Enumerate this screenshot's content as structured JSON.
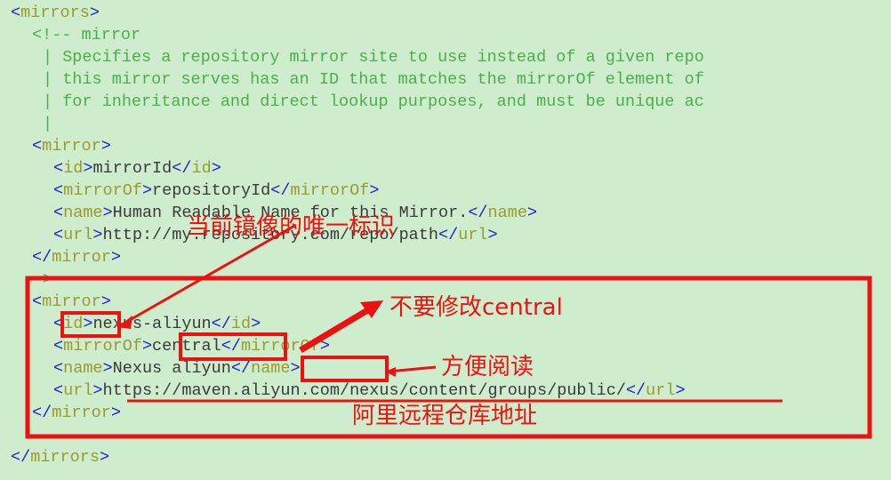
{
  "editor": {
    "background_color": "#cdedcd",
    "bracket_color": "#2222cc",
    "tag_color": "#9a9a2e",
    "text_color": "#3a3a3a",
    "comment_color": "#4cae4c",
    "annotation_color": "#ee1111",
    "language": "xml"
  },
  "code": {
    "lines": [
      {
        "indent": 0,
        "parts": [
          {
            "cls": "brk",
            "t": "<"
          },
          {
            "cls": "tag",
            "t": "mirrors"
          },
          {
            "cls": "brk",
            "t": ">"
          }
        ]
      },
      {
        "indent": 2,
        "parts": [
          {
            "cls": "cmt",
            "t": "<!-- mirror"
          }
        ]
      },
      {
        "indent": 3,
        "parts": [
          {
            "cls": "cmt",
            "t": "| Specifies a repository mirror site to use instead of a given repo"
          }
        ]
      },
      {
        "indent": 3,
        "parts": [
          {
            "cls": "cmt",
            "t": "| this mirror serves has an ID that matches the mirrorOf element of"
          }
        ]
      },
      {
        "indent": 3,
        "parts": [
          {
            "cls": "cmt",
            "t": "| for inheritance and direct lookup purposes, and must be unique ac"
          }
        ]
      },
      {
        "indent": 3,
        "parts": [
          {
            "cls": "cmt",
            "t": "|"
          }
        ]
      },
      {
        "indent": 2,
        "parts": [
          {
            "cls": "brk",
            "t": "<"
          },
          {
            "cls": "tag",
            "t": "mirror"
          },
          {
            "cls": "brk",
            "t": ">"
          }
        ]
      },
      {
        "indent": 4,
        "parts": [
          {
            "cls": "brk",
            "t": "<"
          },
          {
            "cls": "tag",
            "t": "id"
          },
          {
            "cls": "brk",
            "t": ">"
          },
          {
            "cls": "txt",
            "t": "mirrorId"
          },
          {
            "cls": "brk",
            "t": "</"
          },
          {
            "cls": "tag",
            "t": "id"
          },
          {
            "cls": "brk",
            "t": ">"
          }
        ]
      },
      {
        "indent": 4,
        "parts": [
          {
            "cls": "brk",
            "t": "<"
          },
          {
            "cls": "tag",
            "t": "mirrorOf"
          },
          {
            "cls": "brk",
            "t": ">"
          },
          {
            "cls": "txt",
            "t": "repositoryId"
          },
          {
            "cls": "brk",
            "t": "</"
          },
          {
            "cls": "tag",
            "t": "mirrorOf"
          },
          {
            "cls": "brk",
            "t": ">"
          }
        ]
      },
      {
        "indent": 4,
        "parts": [
          {
            "cls": "brk",
            "t": "<"
          },
          {
            "cls": "tag",
            "t": "name"
          },
          {
            "cls": "brk",
            "t": ">"
          },
          {
            "cls": "txt",
            "t": "Human Readable Name for this Mirror."
          },
          {
            "cls": "brk",
            "t": "</"
          },
          {
            "cls": "tag",
            "t": "name"
          },
          {
            "cls": "brk",
            "t": ">"
          }
        ]
      },
      {
        "indent": 4,
        "parts": [
          {
            "cls": "brk",
            "t": "<"
          },
          {
            "cls": "tag",
            "t": "url"
          },
          {
            "cls": "brk",
            "t": ">"
          },
          {
            "cls": "txt",
            "t": "http://my.repository.com/repo/path"
          },
          {
            "cls": "brk",
            "t": "</"
          },
          {
            "cls": "tag",
            "t": "url"
          },
          {
            "cls": "brk",
            "t": ">"
          }
        ]
      },
      {
        "indent": 2,
        "parts": [
          {
            "cls": "brk",
            "t": "</"
          },
          {
            "cls": "tag",
            "t": "mirror"
          },
          {
            "cls": "brk",
            "t": ">"
          }
        ]
      },
      {
        "indent": 3,
        "parts": [
          {
            "cls": "cmt",
            "t": ">"
          }
        ]
      },
      {
        "indent": 2,
        "parts": [
          {
            "cls": "brk",
            "t": "<"
          },
          {
            "cls": "tag",
            "t": "mirror"
          },
          {
            "cls": "brk",
            "t": ">"
          }
        ]
      },
      {
        "indent": 4,
        "parts": [
          {
            "cls": "brk",
            "t": "<"
          },
          {
            "cls": "tag",
            "t": "id"
          },
          {
            "cls": "brk",
            "t": ">"
          },
          {
            "cls": "txt",
            "t": "nexus-aliyun"
          },
          {
            "cls": "brk",
            "t": "</"
          },
          {
            "cls": "tag",
            "t": "id"
          },
          {
            "cls": "brk",
            "t": ">"
          }
        ]
      },
      {
        "indent": 4,
        "parts": [
          {
            "cls": "brk",
            "t": "<"
          },
          {
            "cls": "tag",
            "t": "mirrorOf"
          },
          {
            "cls": "brk",
            "t": ">"
          },
          {
            "cls": "txt",
            "t": "central"
          },
          {
            "cls": "brk",
            "t": "</"
          },
          {
            "cls": "tag",
            "t": "mirrorOf"
          },
          {
            "cls": "brk",
            "t": ">"
          }
        ]
      },
      {
        "indent": 4,
        "parts": [
          {
            "cls": "brk",
            "t": "<"
          },
          {
            "cls": "tag",
            "t": "name"
          },
          {
            "cls": "brk",
            "t": ">"
          },
          {
            "cls": "txt",
            "t": "Nexus aliyun"
          },
          {
            "cls": "brk",
            "t": "</"
          },
          {
            "cls": "tag",
            "t": "name"
          },
          {
            "cls": "brk",
            "t": ">"
          }
        ]
      },
      {
        "indent": 4,
        "parts": [
          {
            "cls": "brk",
            "t": "<"
          },
          {
            "cls": "tag",
            "t": "url"
          },
          {
            "cls": "brk",
            "t": ">"
          },
          {
            "cls": "txt",
            "t": "https://maven.aliyun.com/nexus/content/groups/public/"
          },
          {
            "cls": "brk",
            "t": "</"
          },
          {
            "cls": "tag",
            "t": "url"
          },
          {
            "cls": "brk",
            "t": ">"
          }
        ]
      },
      {
        "indent": 2,
        "parts": [
          {
            "cls": "brk",
            "t": "</"
          },
          {
            "cls": "tag",
            "t": "mirror"
          },
          {
            "cls": "brk",
            "t": ">"
          }
        ]
      },
      {
        "indent": 0,
        "parts": []
      },
      {
        "indent": 0,
        "parts": [
          {
            "cls": "brk",
            "t": "</"
          },
          {
            "cls": "tag",
            "t": "mirrors"
          },
          {
            "cls": "brk",
            "t": ">"
          }
        ]
      }
    ]
  },
  "annotations": {
    "note_unique_id": "当前镜像的唯一标识",
    "note_do_not_modify_central": "不要修改central",
    "note_easy_reading": "方便阅读",
    "note_aliyun_remote_repo": "阿里远程仓库地址"
  }
}
